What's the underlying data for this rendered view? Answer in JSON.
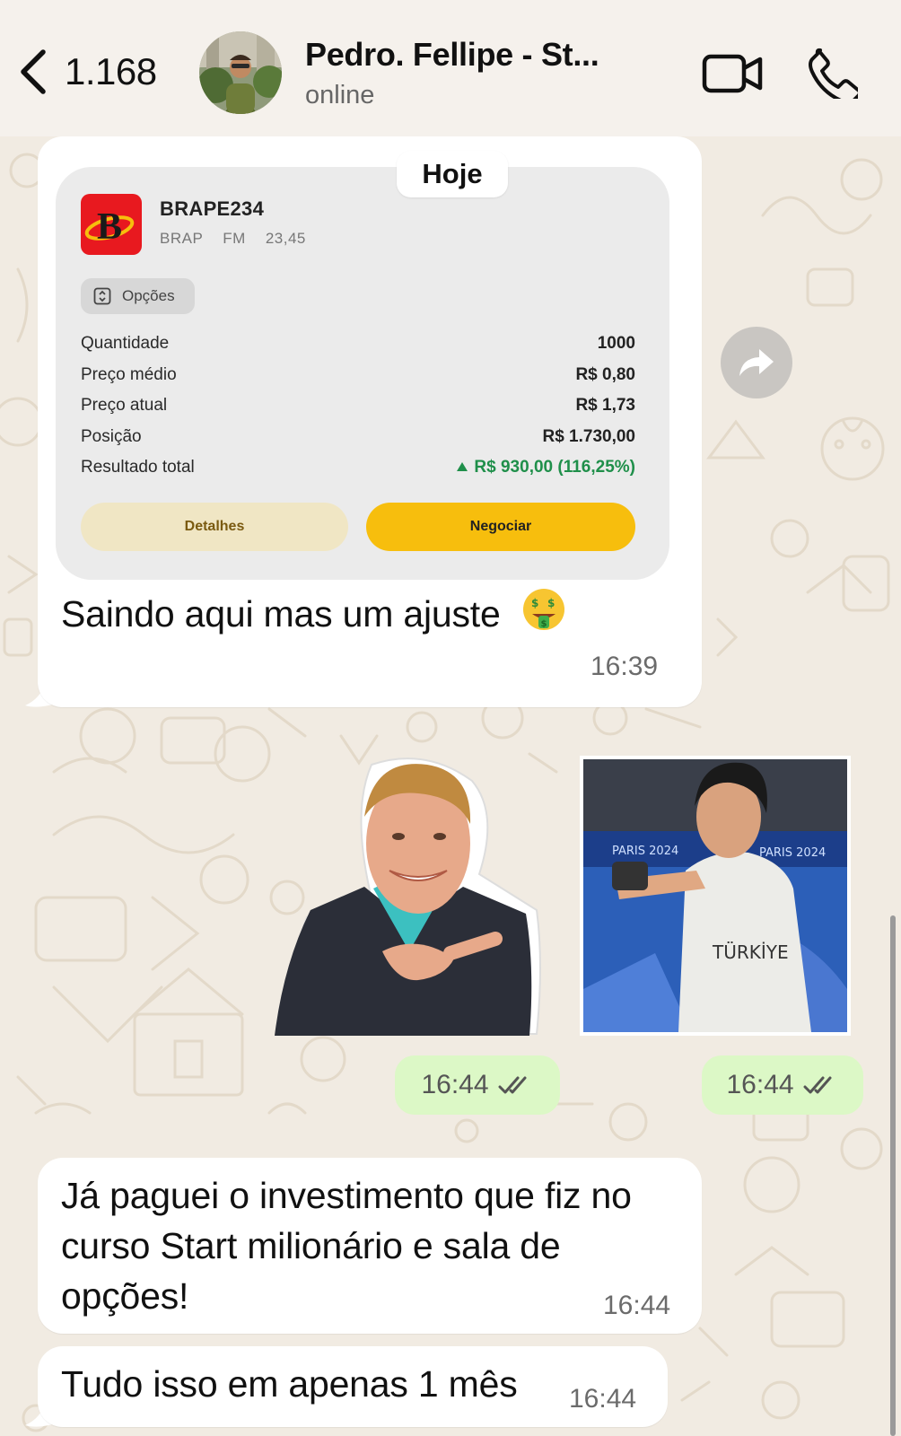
{
  "header": {
    "back_count": "1.168",
    "contact_name": "Pedro. Fellipe - St...",
    "contact_status": "online",
    "icons": [
      "chevron-left-icon",
      "video-camera-icon",
      "phone-icon"
    ]
  },
  "date_divider": "Hoje",
  "messages": [
    {
      "direction": "incoming",
      "card": {
        "ticker": "BRAPE234",
        "market": "BRAP",
        "type": "FM",
        "strike": "23,45",
        "options_label": "Opções",
        "rows": [
          {
            "label": "Quantidade",
            "value": "1000"
          },
          {
            "label": "Preço médio",
            "value": "R$ 0,80"
          },
          {
            "label": "Preço atual",
            "value": "R$ 1,73"
          },
          {
            "label": "Posição",
            "value": "R$ 1.730,00"
          },
          {
            "label": "Resultado total",
            "value": "R$ 930,00 (116,25%)"
          }
        ],
        "details_button": "Detalhes",
        "trade_button": "Negociar"
      },
      "text": "Saindo aqui mas um ajuste",
      "emoji": "money-mouth-face-icon",
      "time": "16:39"
    },
    {
      "direction": "outgoing",
      "type": "sticker",
      "time": "16:44",
      "status": "read"
    },
    {
      "direction": "outgoing",
      "type": "sticker",
      "time": "16:44",
      "status": "read",
      "sticker_text": "TÜRKİYE"
    },
    {
      "direction": "incoming",
      "text_lines": [
        "Já paguei o investimento que fiz no",
        "curso Start milionário e sala de",
        "opções!"
      ],
      "time": "16:44"
    },
    {
      "direction": "incoming",
      "text": "Tudo isso em apenas 1 mês",
      "time": "16:44"
    }
  ],
  "colors": {
    "background": "#f1ebe2",
    "incoming_bubble": "#ffffff",
    "outgoing_bubble": "#dcf8c6",
    "positive": "#1f8f4a",
    "trade_button": "#f7be0d",
    "logo_red": "#e8191f"
  }
}
